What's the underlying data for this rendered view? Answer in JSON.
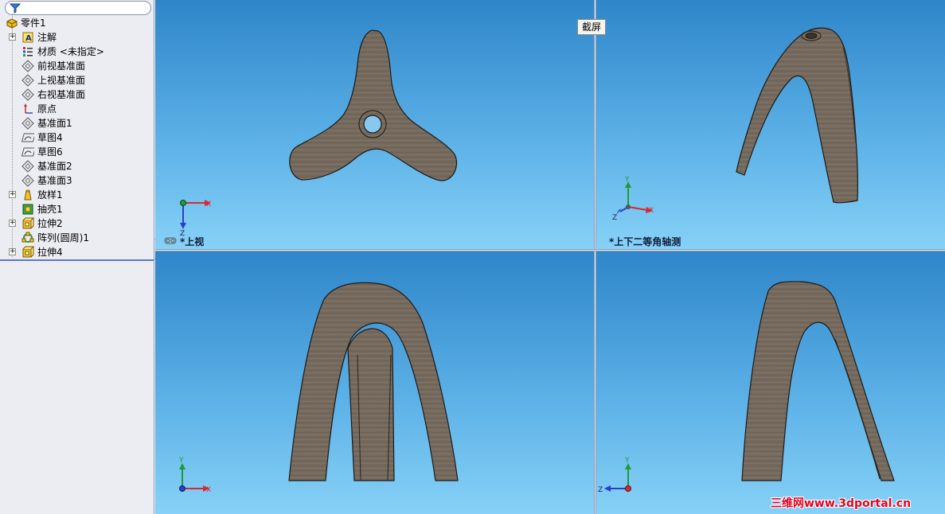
{
  "feature_tree": {
    "root": {
      "label": "零件1",
      "icon": "part-icon"
    },
    "items": [
      {
        "label": "注解",
        "icon": "annotation-icon",
        "expandable": true
      },
      {
        "label": "材质 <未指定>",
        "icon": "material-icon",
        "expandable": false
      },
      {
        "label": "前视基准面",
        "icon": "plane-icon",
        "expandable": false
      },
      {
        "label": "上视基准面",
        "icon": "plane-icon",
        "expandable": false
      },
      {
        "label": "右视基准面",
        "icon": "plane-icon",
        "expandable": false
      },
      {
        "label": "原点",
        "icon": "origin-icon",
        "expandable": false
      },
      {
        "label": "基准面1",
        "icon": "plane-icon",
        "expandable": false
      },
      {
        "label": "草图4",
        "icon": "sketch-icon",
        "expandable": false
      },
      {
        "label": "草图6",
        "icon": "sketch-icon",
        "expandable": false
      },
      {
        "label": "基准面2",
        "icon": "plane-icon",
        "expandable": false
      },
      {
        "label": "基准面3",
        "icon": "plane-icon",
        "expandable": false
      },
      {
        "label": "放样1",
        "icon": "loft-icon",
        "expandable": true
      },
      {
        "label": "抽壳1",
        "icon": "shell-icon",
        "expandable": false
      },
      {
        "label": "拉伸2",
        "icon": "extrude-icon",
        "expandable": true
      },
      {
        "label": "阵列(圆周)1",
        "icon": "circular-pattern-icon",
        "expandable": false
      },
      {
        "label": "拉伸4",
        "icon": "extrude-icon",
        "expandable": true
      }
    ]
  },
  "viewports": {
    "top_left": {
      "label": "*上视",
      "axes": [
        "X",
        "Z"
      ]
    },
    "top_right": {
      "label": "*上下二等角轴测",
      "axes": [
        "Y",
        "Z",
        "X"
      ]
    },
    "bottom_left": {
      "axes": [
        "Y",
        "X"
      ]
    },
    "bottom_right": {
      "axes": [
        "Y",
        "Z"
      ]
    }
  },
  "tooltip": "截屏",
  "watermark": "三维网www.3dportal.cn",
  "colors": {
    "viewport_top": "#2f86c9",
    "viewport_bottom": "#86d1f7",
    "model_fill": "#756a5d",
    "model_edge": "#1e1a16",
    "axis_x": "#d8282b",
    "axis_y": "#1f9a35",
    "axis_z": "#2a3fc8",
    "watermark": "#e5001e"
  }
}
